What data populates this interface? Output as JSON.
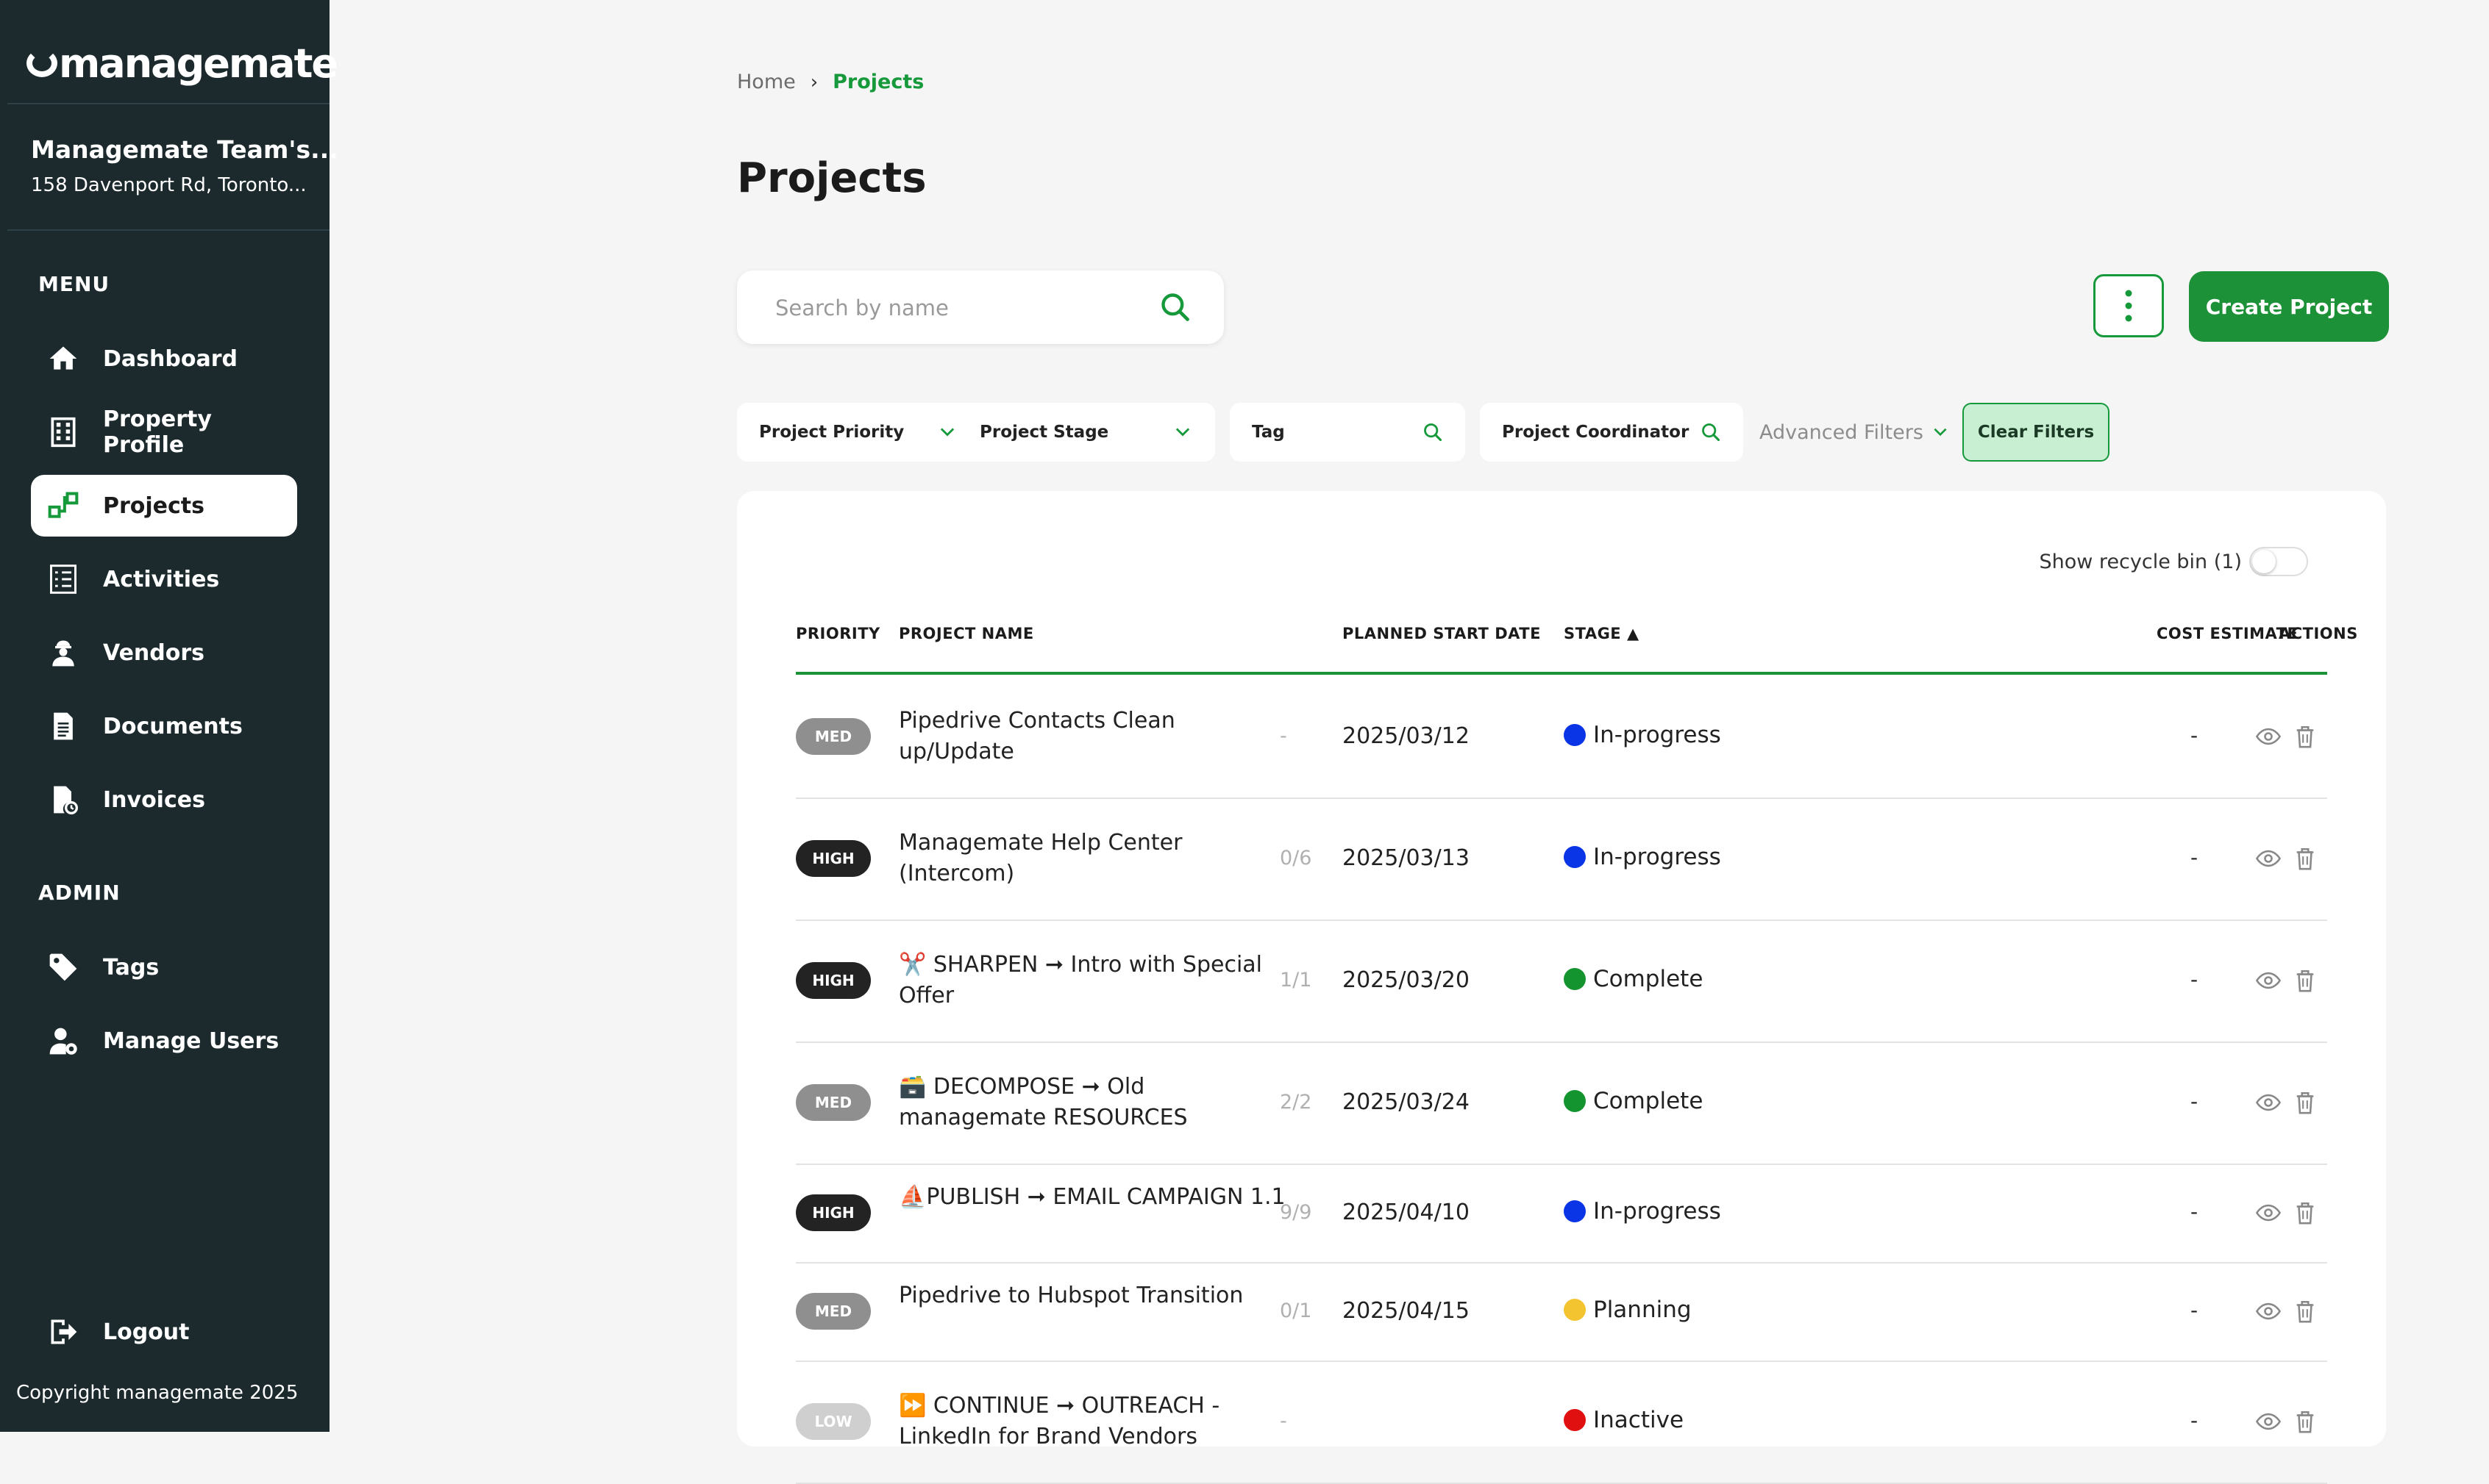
{
  "brand": {
    "name": "managemate"
  },
  "team": {
    "name": "Managemate Team's...",
    "address": "158 Davenport Rd, Toronto..."
  },
  "menu": {
    "title": "MENU",
    "items": [
      {
        "label": "Dashboard",
        "icon": "home-icon"
      },
      {
        "label": "Property Profile",
        "icon": "building-icon"
      },
      {
        "label": "Projects",
        "icon": "projects-icon",
        "active": true
      },
      {
        "label": "Activities",
        "icon": "checklist-icon"
      },
      {
        "label": "Vendors",
        "icon": "worker-icon"
      },
      {
        "label": "Documents",
        "icon": "document-icon"
      },
      {
        "label": "Invoices",
        "icon": "invoice-icon"
      }
    ]
  },
  "admin": {
    "title": "ADMIN",
    "items": [
      {
        "label": "Tags",
        "icon": "tag-icon"
      },
      {
        "label": "Manage Users",
        "icon": "user-gear-icon"
      }
    ]
  },
  "logout": {
    "label": "Logout"
  },
  "copyright": "Copyright managemate 2025",
  "breadcrumb": {
    "home": "Home",
    "current": "Projects"
  },
  "page": {
    "title": "Projects"
  },
  "search": {
    "placeholder": "Search by name",
    "value": ""
  },
  "toolbar": {
    "create_label": "Create Project"
  },
  "filters": {
    "priority": "Project Priority",
    "stage": "Project Stage",
    "tag": "Tag",
    "coordinator": "Project Coordinator",
    "advanced": "Advanced Filters",
    "clear": "Clear Filters"
  },
  "recycle": {
    "label": "Show recycle bin (1)",
    "enabled": false
  },
  "table": {
    "headers": {
      "priority": "PRIORITY",
      "name": "PROJECT NAME",
      "start": "PLANNED START DATE",
      "stage": "STAGE ▲",
      "cost": "COST ESTIMATE",
      "actions": "ACTIONS"
    },
    "rows": [
      {
        "priority": "MED",
        "name": "Pipedrive Contacts Clean up/Update",
        "count": "-",
        "start": "2025/03/12",
        "stage": "In-progress",
        "stage_color": "#0a35e6",
        "cost": "-"
      },
      {
        "priority": "HIGH",
        "name": "Managemate Help Center (Intercom)",
        "count": "0/6",
        "start": "2025/03/13",
        "stage": "In-progress",
        "stage_color": "#0a35e6",
        "cost": "-"
      },
      {
        "priority": "HIGH",
        "name": "✂️ SHARPEN ➞ Intro with Special Offer",
        "count": "1/1",
        "start": "2025/03/20",
        "stage": "Complete",
        "stage_color": "#14942e",
        "cost": "-"
      },
      {
        "priority": "MED",
        "name": "🗃️ DECOMPOSE ➞ Old managemate RESOURCES",
        "count": "2/2",
        "start": "2025/03/24",
        "stage": "Complete",
        "stage_color": "#14942e",
        "cost": "-"
      },
      {
        "priority": "HIGH",
        "name": "⛵PUBLISH ➞ EMAIL CAMPAIGN 1.1",
        "count": "9/9",
        "start": "2025/04/10",
        "stage": "In-progress",
        "stage_color": "#0a35e6",
        "cost": "-"
      },
      {
        "priority": "MED",
        "name": "Pipedrive to Hubspot Transition",
        "count": "0/1",
        "start": "2025/04/15",
        "stage": "Planning",
        "stage_color": "#f4c430",
        "cost": "-"
      },
      {
        "priority": "LOW",
        "name": "⏩ CONTINUE ➞ OUTREACH - LinkedIn for Brand Vendors",
        "count": "-",
        "start": "",
        "stage": "Inactive",
        "stage_color": "#e01010",
        "cost": "-"
      }
    ]
  },
  "colors": {
    "accent": "#1d9137",
    "sidebar_bg": "#1c2a2e",
    "page_bg": "#f5f5f5"
  }
}
